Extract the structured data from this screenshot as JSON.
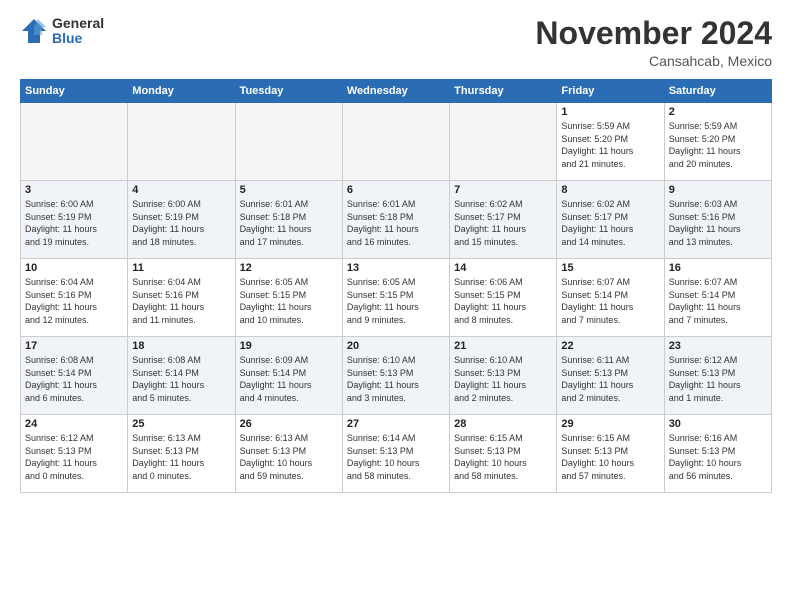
{
  "header": {
    "logo_general": "General",
    "logo_blue": "Blue",
    "title": "November 2024",
    "location": "Cansahcab, Mexico"
  },
  "weekdays": [
    "Sunday",
    "Monday",
    "Tuesday",
    "Wednesday",
    "Thursday",
    "Friday",
    "Saturday"
  ],
  "weeks": [
    [
      {
        "day": "",
        "info": ""
      },
      {
        "day": "",
        "info": ""
      },
      {
        "day": "",
        "info": ""
      },
      {
        "day": "",
        "info": ""
      },
      {
        "day": "",
        "info": ""
      },
      {
        "day": "1",
        "info": "Sunrise: 5:59 AM\nSunset: 5:20 PM\nDaylight: 11 hours\nand 21 minutes."
      },
      {
        "day": "2",
        "info": "Sunrise: 5:59 AM\nSunset: 5:20 PM\nDaylight: 11 hours\nand 20 minutes."
      }
    ],
    [
      {
        "day": "3",
        "info": "Sunrise: 6:00 AM\nSunset: 5:19 PM\nDaylight: 11 hours\nand 19 minutes."
      },
      {
        "day": "4",
        "info": "Sunrise: 6:00 AM\nSunset: 5:19 PM\nDaylight: 11 hours\nand 18 minutes."
      },
      {
        "day": "5",
        "info": "Sunrise: 6:01 AM\nSunset: 5:18 PM\nDaylight: 11 hours\nand 17 minutes."
      },
      {
        "day": "6",
        "info": "Sunrise: 6:01 AM\nSunset: 5:18 PM\nDaylight: 11 hours\nand 16 minutes."
      },
      {
        "day": "7",
        "info": "Sunrise: 6:02 AM\nSunset: 5:17 PM\nDaylight: 11 hours\nand 15 minutes."
      },
      {
        "day": "8",
        "info": "Sunrise: 6:02 AM\nSunset: 5:17 PM\nDaylight: 11 hours\nand 14 minutes."
      },
      {
        "day": "9",
        "info": "Sunrise: 6:03 AM\nSunset: 5:16 PM\nDaylight: 11 hours\nand 13 minutes."
      }
    ],
    [
      {
        "day": "10",
        "info": "Sunrise: 6:04 AM\nSunset: 5:16 PM\nDaylight: 11 hours\nand 12 minutes."
      },
      {
        "day": "11",
        "info": "Sunrise: 6:04 AM\nSunset: 5:16 PM\nDaylight: 11 hours\nand 11 minutes."
      },
      {
        "day": "12",
        "info": "Sunrise: 6:05 AM\nSunset: 5:15 PM\nDaylight: 11 hours\nand 10 minutes."
      },
      {
        "day": "13",
        "info": "Sunrise: 6:05 AM\nSunset: 5:15 PM\nDaylight: 11 hours\nand 9 minutes."
      },
      {
        "day": "14",
        "info": "Sunrise: 6:06 AM\nSunset: 5:15 PM\nDaylight: 11 hours\nand 8 minutes."
      },
      {
        "day": "15",
        "info": "Sunrise: 6:07 AM\nSunset: 5:14 PM\nDaylight: 11 hours\nand 7 minutes."
      },
      {
        "day": "16",
        "info": "Sunrise: 6:07 AM\nSunset: 5:14 PM\nDaylight: 11 hours\nand 7 minutes."
      }
    ],
    [
      {
        "day": "17",
        "info": "Sunrise: 6:08 AM\nSunset: 5:14 PM\nDaylight: 11 hours\nand 6 minutes."
      },
      {
        "day": "18",
        "info": "Sunrise: 6:08 AM\nSunset: 5:14 PM\nDaylight: 11 hours\nand 5 minutes."
      },
      {
        "day": "19",
        "info": "Sunrise: 6:09 AM\nSunset: 5:14 PM\nDaylight: 11 hours\nand 4 minutes."
      },
      {
        "day": "20",
        "info": "Sunrise: 6:10 AM\nSunset: 5:13 PM\nDaylight: 11 hours\nand 3 minutes."
      },
      {
        "day": "21",
        "info": "Sunrise: 6:10 AM\nSunset: 5:13 PM\nDaylight: 11 hours\nand 2 minutes."
      },
      {
        "day": "22",
        "info": "Sunrise: 6:11 AM\nSunset: 5:13 PM\nDaylight: 11 hours\nand 2 minutes."
      },
      {
        "day": "23",
        "info": "Sunrise: 6:12 AM\nSunset: 5:13 PM\nDaylight: 11 hours\nand 1 minute."
      }
    ],
    [
      {
        "day": "24",
        "info": "Sunrise: 6:12 AM\nSunset: 5:13 PM\nDaylight: 11 hours\nand 0 minutes."
      },
      {
        "day": "25",
        "info": "Sunrise: 6:13 AM\nSunset: 5:13 PM\nDaylight: 11 hours\nand 0 minutes."
      },
      {
        "day": "26",
        "info": "Sunrise: 6:13 AM\nSunset: 5:13 PM\nDaylight: 10 hours\nand 59 minutes."
      },
      {
        "day": "27",
        "info": "Sunrise: 6:14 AM\nSunset: 5:13 PM\nDaylight: 10 hours\nand 58 minutes."
      },
      {
        "day": "28",
        "info": "Sunrise: 6:15 AM\nSunset: 5:13 PM\nDaylight: 10 hours\nand 58 minutes."
      },
      {
        "day": "29",
        "info": "Sunrise: 6:15 AM\nSunset: 5:13 PM\nDaylight: 10 hours\nand 57 minutes."
      },
      {
        "day": "30",
        "info": "Sunrise: 6:16 AM\nSunset: 5:13 PM\nDaylight: 10 hours\nand 56 minutes."
      }
    ]
  ]
}
